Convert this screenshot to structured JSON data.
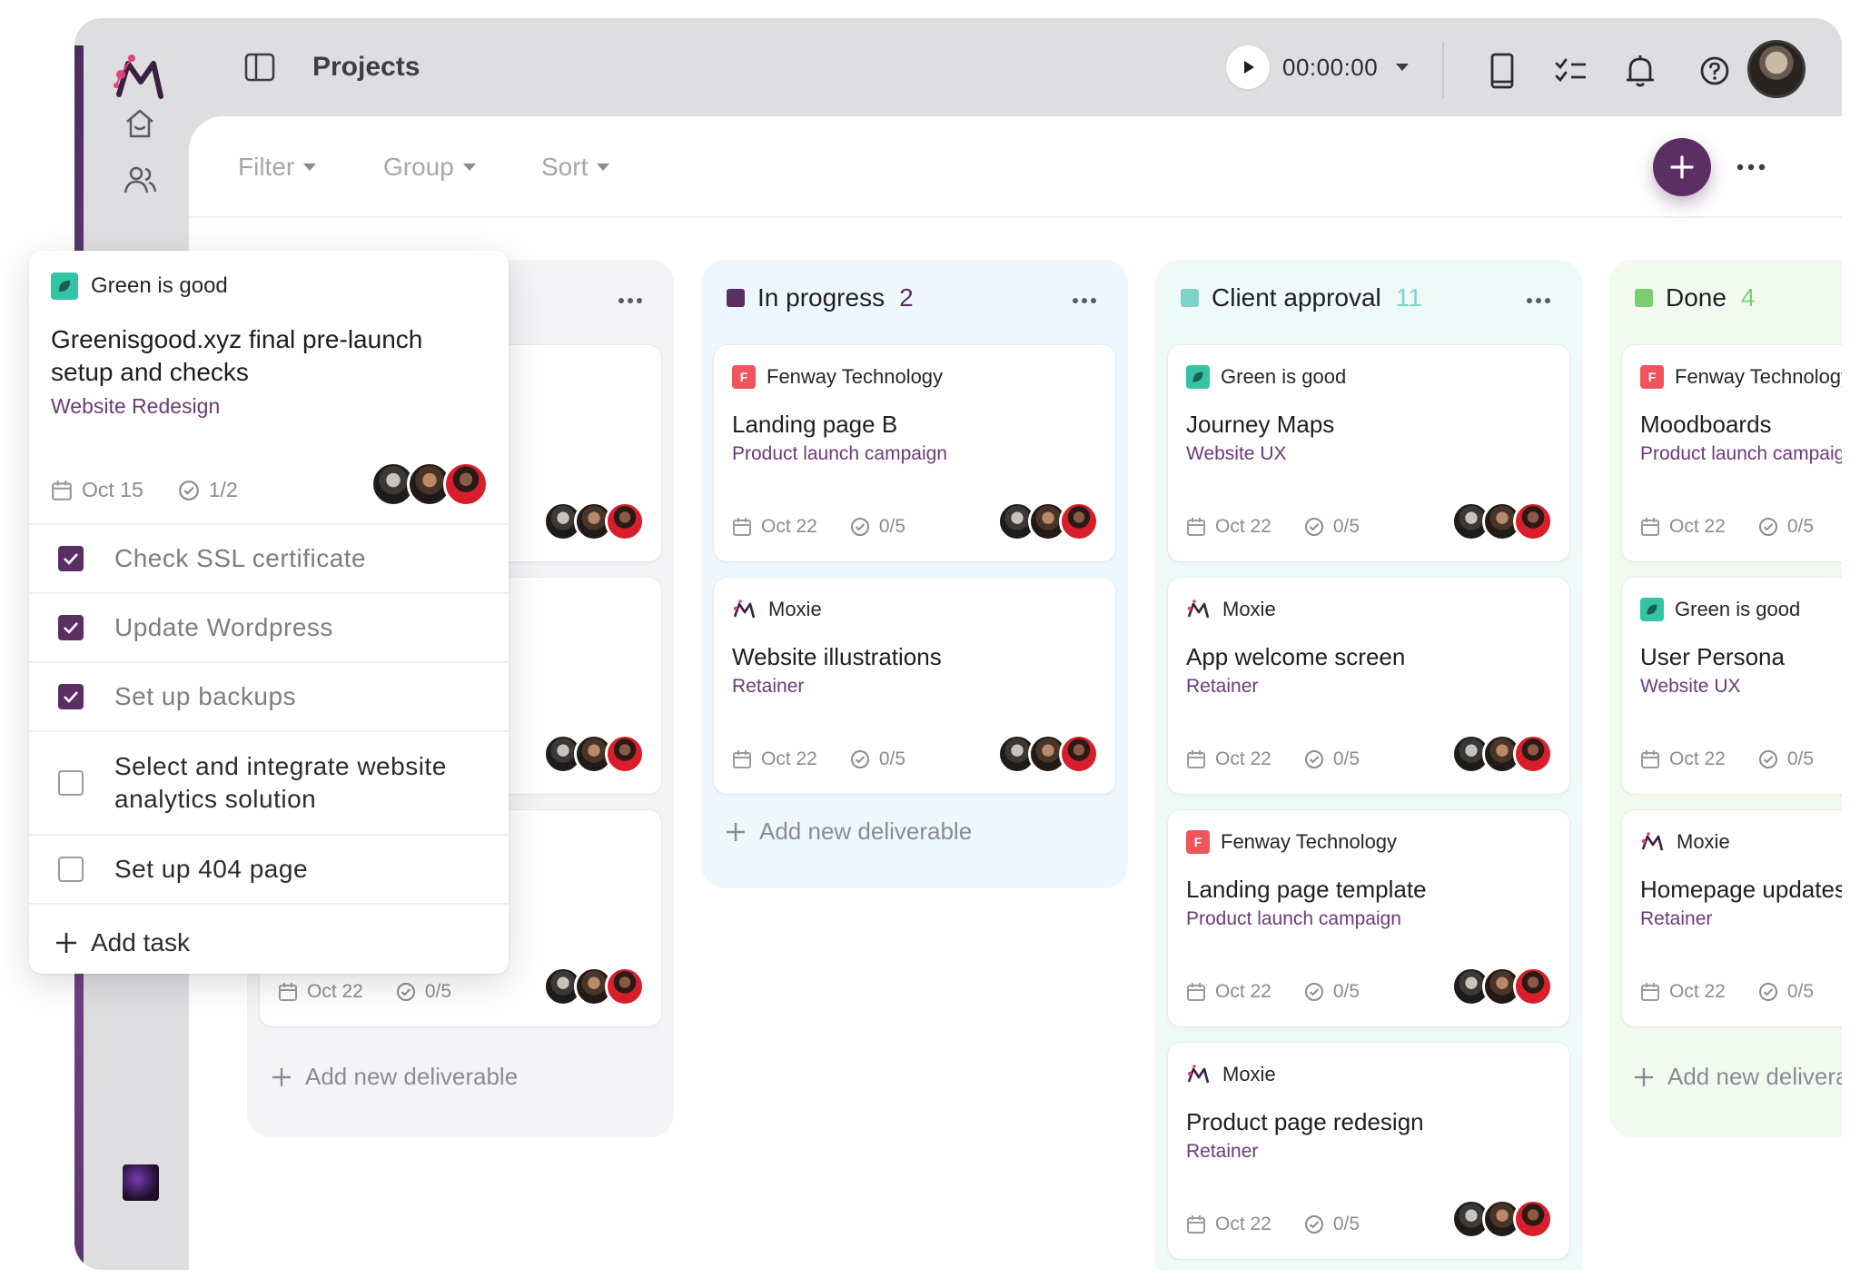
{
  "header": {
    "title": "Projects"
  },
  "timer": {
    "value": "00:00:00"
  },
  "toolbar": {
    "filter": "Filter",
    "group": "Group",
    "sort": "Sort"
  },
  "columns": [
    {
      "name": "",
      "count": "",
      "color": "#b9b9c0",
      "add_label": "Add new deliverable",
      "cards": [
        {
          "meta_date": "Oct 22",
          "meta_tasks": "0/5"
        }
      ]
    },
    {
      "name": "In progress",
      "count": "2",
      "color": "#5b2f64",
      "count_color": "#5b2f64",
      "add_label": "Add new deliverable",
      "cards": [
        {
          "client": "Fenway Technology",
          "badge": "F",
          "title": "Landing page B",
          "project": "Product launch campaign",
          "date": "Oct 22",
          "tasks": "0/5"
        },
        {
          "client": "Moxie",
          "title": "Website illustrations",
          "project": "Retainer",
          "date": "Oct 22",
          "tasks": "0/5"
        }
      ]
    },
    {
      "name": "Client approval",
      "count": "11",
      "color": "#7fd2c6",
      "count_color": "#7fd2c6",
      "cards": [
        {
          "client": "Green is good",
          "title": "Journey Maps",
          "project": "Website UX",
          "date": "Oct 22",
          "tasks": "0/5"
        },
        {
          "client": "Moxie",
          "title": "App welcome screen",
          "project": "Retainer",
          "date": "Oct 22",
          "tasks": "0/5"
        },
        {
          "client": "Fenway Technology",
          "badge": "F",
          "title": "Landing page template",
          "project": "Product launch campaign",
          "date": "Oct 22",
          "tasks": "0/5"
        },
        {
          "client": "Moxie",
          "title": "Product page redesign",
          "project": "Retainer",
          "date": "Oct 22",
          "tasks": "0/5"
        }
      ]
    },
    {
      "name": "Done",
      "count": "4",
      "color": "#7ccf6f",
      "count_color": "#7ccf6f",
      "add_label": "Add new deliverable",
      "cards": [
        {
          "client": "Fenway Technology",
          "badge": "F",
          "title": "Moodboards",
          "project": "Product launch campaign",
          "date": "Oct 22",
          "tasks": "0/5"
        },
        {
          "client": "Green is good",
          "title": "User Persona",
          "project": "Website UX",
          "date": "Oct 22",
          "tasks": "0/5"
        },
        {
          "client": "Moxie",
          "title": "Homepage updates",
          "project": "Retainer",
          "date": "Oct 22",
          "tasks": "0/5"
        }
      ]
    }
  ],
  "popover": {
    "client": "Green is good",
    "title": "Greenisgood.xyz final pre-launch setup and checks",
    "project": "Website Redesign",
    "date": "Oct 15",
    "tasks": "1/2",
    "checklist": [
      {
        "label": "Check SSL certificate",
        "checked": true
      },
      {
        "label": "Update Wordpress",
        "checked": true
      },
      {
        "label": "Set up backups",
        "checked": true
      },
      {
        "label": "Select and integrate website analytics solution",
        "checked": false
      },
      {
        "label": "Set up 404 page",
        "checked": false
      }
    ],
    "add_task": "Add task"
  },
  "colors": {
    "accent": "#5b2f64",
    "project_text": "#6c3a7a",
    "fenway": "#f0555b",
    "green_is_good": "#33c4a6"
  },
  "icons": [
    "moxie-logo-icon",
    "home-icon",
    "users-icon",
    "sidebar-toggle-icon",
    "play-icon",
    "mobile-icon",
    "checklist-icon",
    "bell-icon",
    "help-icon",
    "plus-icon",
    "more-icon",
    "calendar-icon",
    "check-circle-icon",
    "leaf-icon"
  ]
}
